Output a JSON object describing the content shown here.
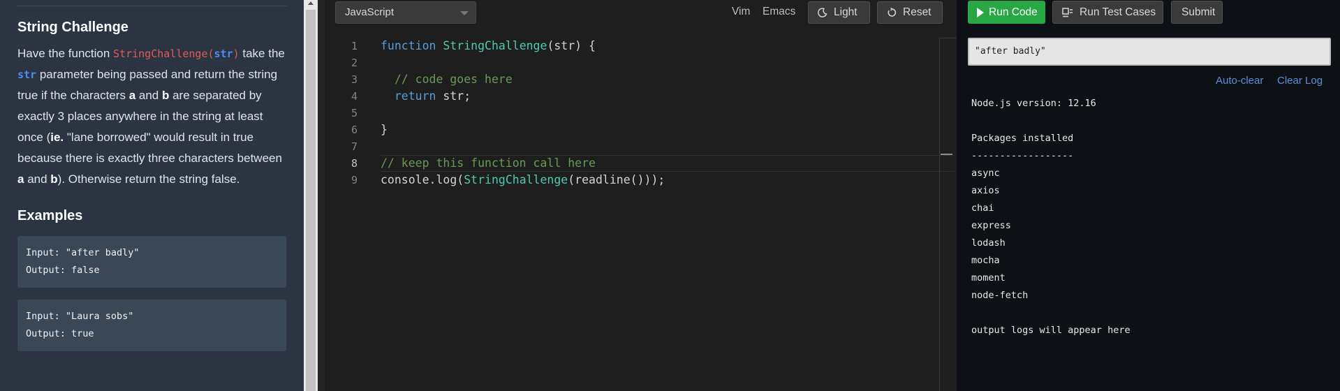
{
  "problem": {
    "title": "String Challenge",
    "desc": {
      "p1": "Have the function ",
      "fn_call": "StringChallenge",
      "fn_open": "(",
      "fn_param": "str",
      "fn_close": ")",
      "p2": " take the ",
      "param": "str",
      "p3": " parameter being passed and return the string true if the characters ",
      "a1": "a",
      "p4": " and ",
      "b1": "b",
      "p5": " are separated by exactly 3 places anywhere in the string at least once (",
      "ie": "ie.",
      "p6": " \"lane borrowed\" would result in true because there is exactly three characters between ",
      "a2": "a",
      "p7": " and ",
      "b2": "b",
      "p8": "). Otherwise return the string false."
    },
    "examples_heading": "Examples",
    "examples": [
      {
        "input": "Input: \"after badly\"",
        "output": "Output: false"
      },
      {
        "input": "Input: \"Laura sobs\"",
        "output": "Output: true"
      }
    ]
  },
  "editor": {
    "language": "JavaScript",
    "vim_label": "Vim",
    "emacs_label": "Emacs",
    "light_label": "Light",
    "reset_label": "Reset",
    "line_numbers": [
      "1",
      "2",
      "3",
      "4",
      "5",
      "6",
      "7",
      "8",
      "9"
    ],
    "code": {
      "l1_kw": "function",
      "l1_fn": "StringChallenge",
      "l1_rest": "(str) {",
      "l3_comment": "// code goes here",
      "l4_kw": "return",
      "l4_rest": " str;",
      "l6": "}",
      "l8_comment": "// keep this function call here",
      "l9_a": "console.log(",
      "l9_fn": "StringChallenge",
      "l9_b": "(readline()));"
    }
  },
  "console": {
    "run_label": "Run Code",
    "test_label": "Run Test Cases",
    "submit_label": "Submit",
    "input_value": "\"after badly\"",
    "auto_clear": "Auto-clear",
    "clear_log": "Clear Log",
    "lines": [
      "Node.js version: 12.16",
      "",
      "Packages installed",
      "------------------",
      "async",
      "axios",
      "chai",
      "express",
      "lodash",
      "mocha",
      "moment",
      "node-fetch",
      "",
      "output logs will appear here"
    ]
  },
  "colors": {
    "run_green": "#28a745",
    "link_blue": "#5f8fdc",
    "left_bg": "#2b3440"
  }
}
